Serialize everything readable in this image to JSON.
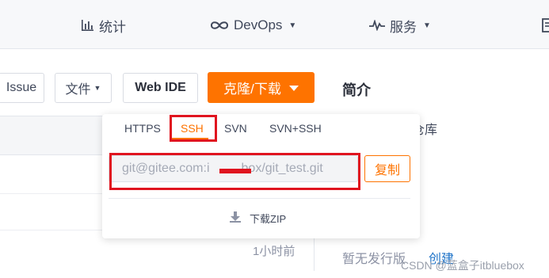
{
  "topnav": {
    "stats": {
      "label": "统计",
      "icon": "bar-chart-icon"
    },
    "devops": {
      "label": "DevOps",
      "icon": "infinity-icon"
    },
    "services": {
      "label": "服务",
      "icon": "pulse-icon"
    },
    "doc": {
      "icon": "document-icon"
    }
  },
  "toolbar": {
    "issue_label": "Issue",
    "file_label": "文件",
    "webide_label": "Web IDE",
    "clone_label": "克隆/下载",
    "intro_label": "简介"
  },
  "clone_dropdown": {
    "tabs": [
      "HTTPS",
      "SSH",
      "SVN",
      "SVN+SSH"
    ],
    "active_tab": "SSH",
    "url_value": "git@gitee.com:i",
    "url_value_tail": "box/git_test.git",
    "copy_label": "复制",
    "download_label": "下载ZIP"
  },
  "file_list": {
    "time_label": "1小时前"
  },
  "sidebar_right": {
    "repo_label": "仓库",
    "release_label": "暂无发行版",
    "create_label": "创建"
  },
  "watermark": "CSDN @蓝盒子itbluebox",
  "colors": {
    "accent": "#fe7300",
    "annotation_red": "#e0141f",
    "link": "#1e73c8"
  }
}
